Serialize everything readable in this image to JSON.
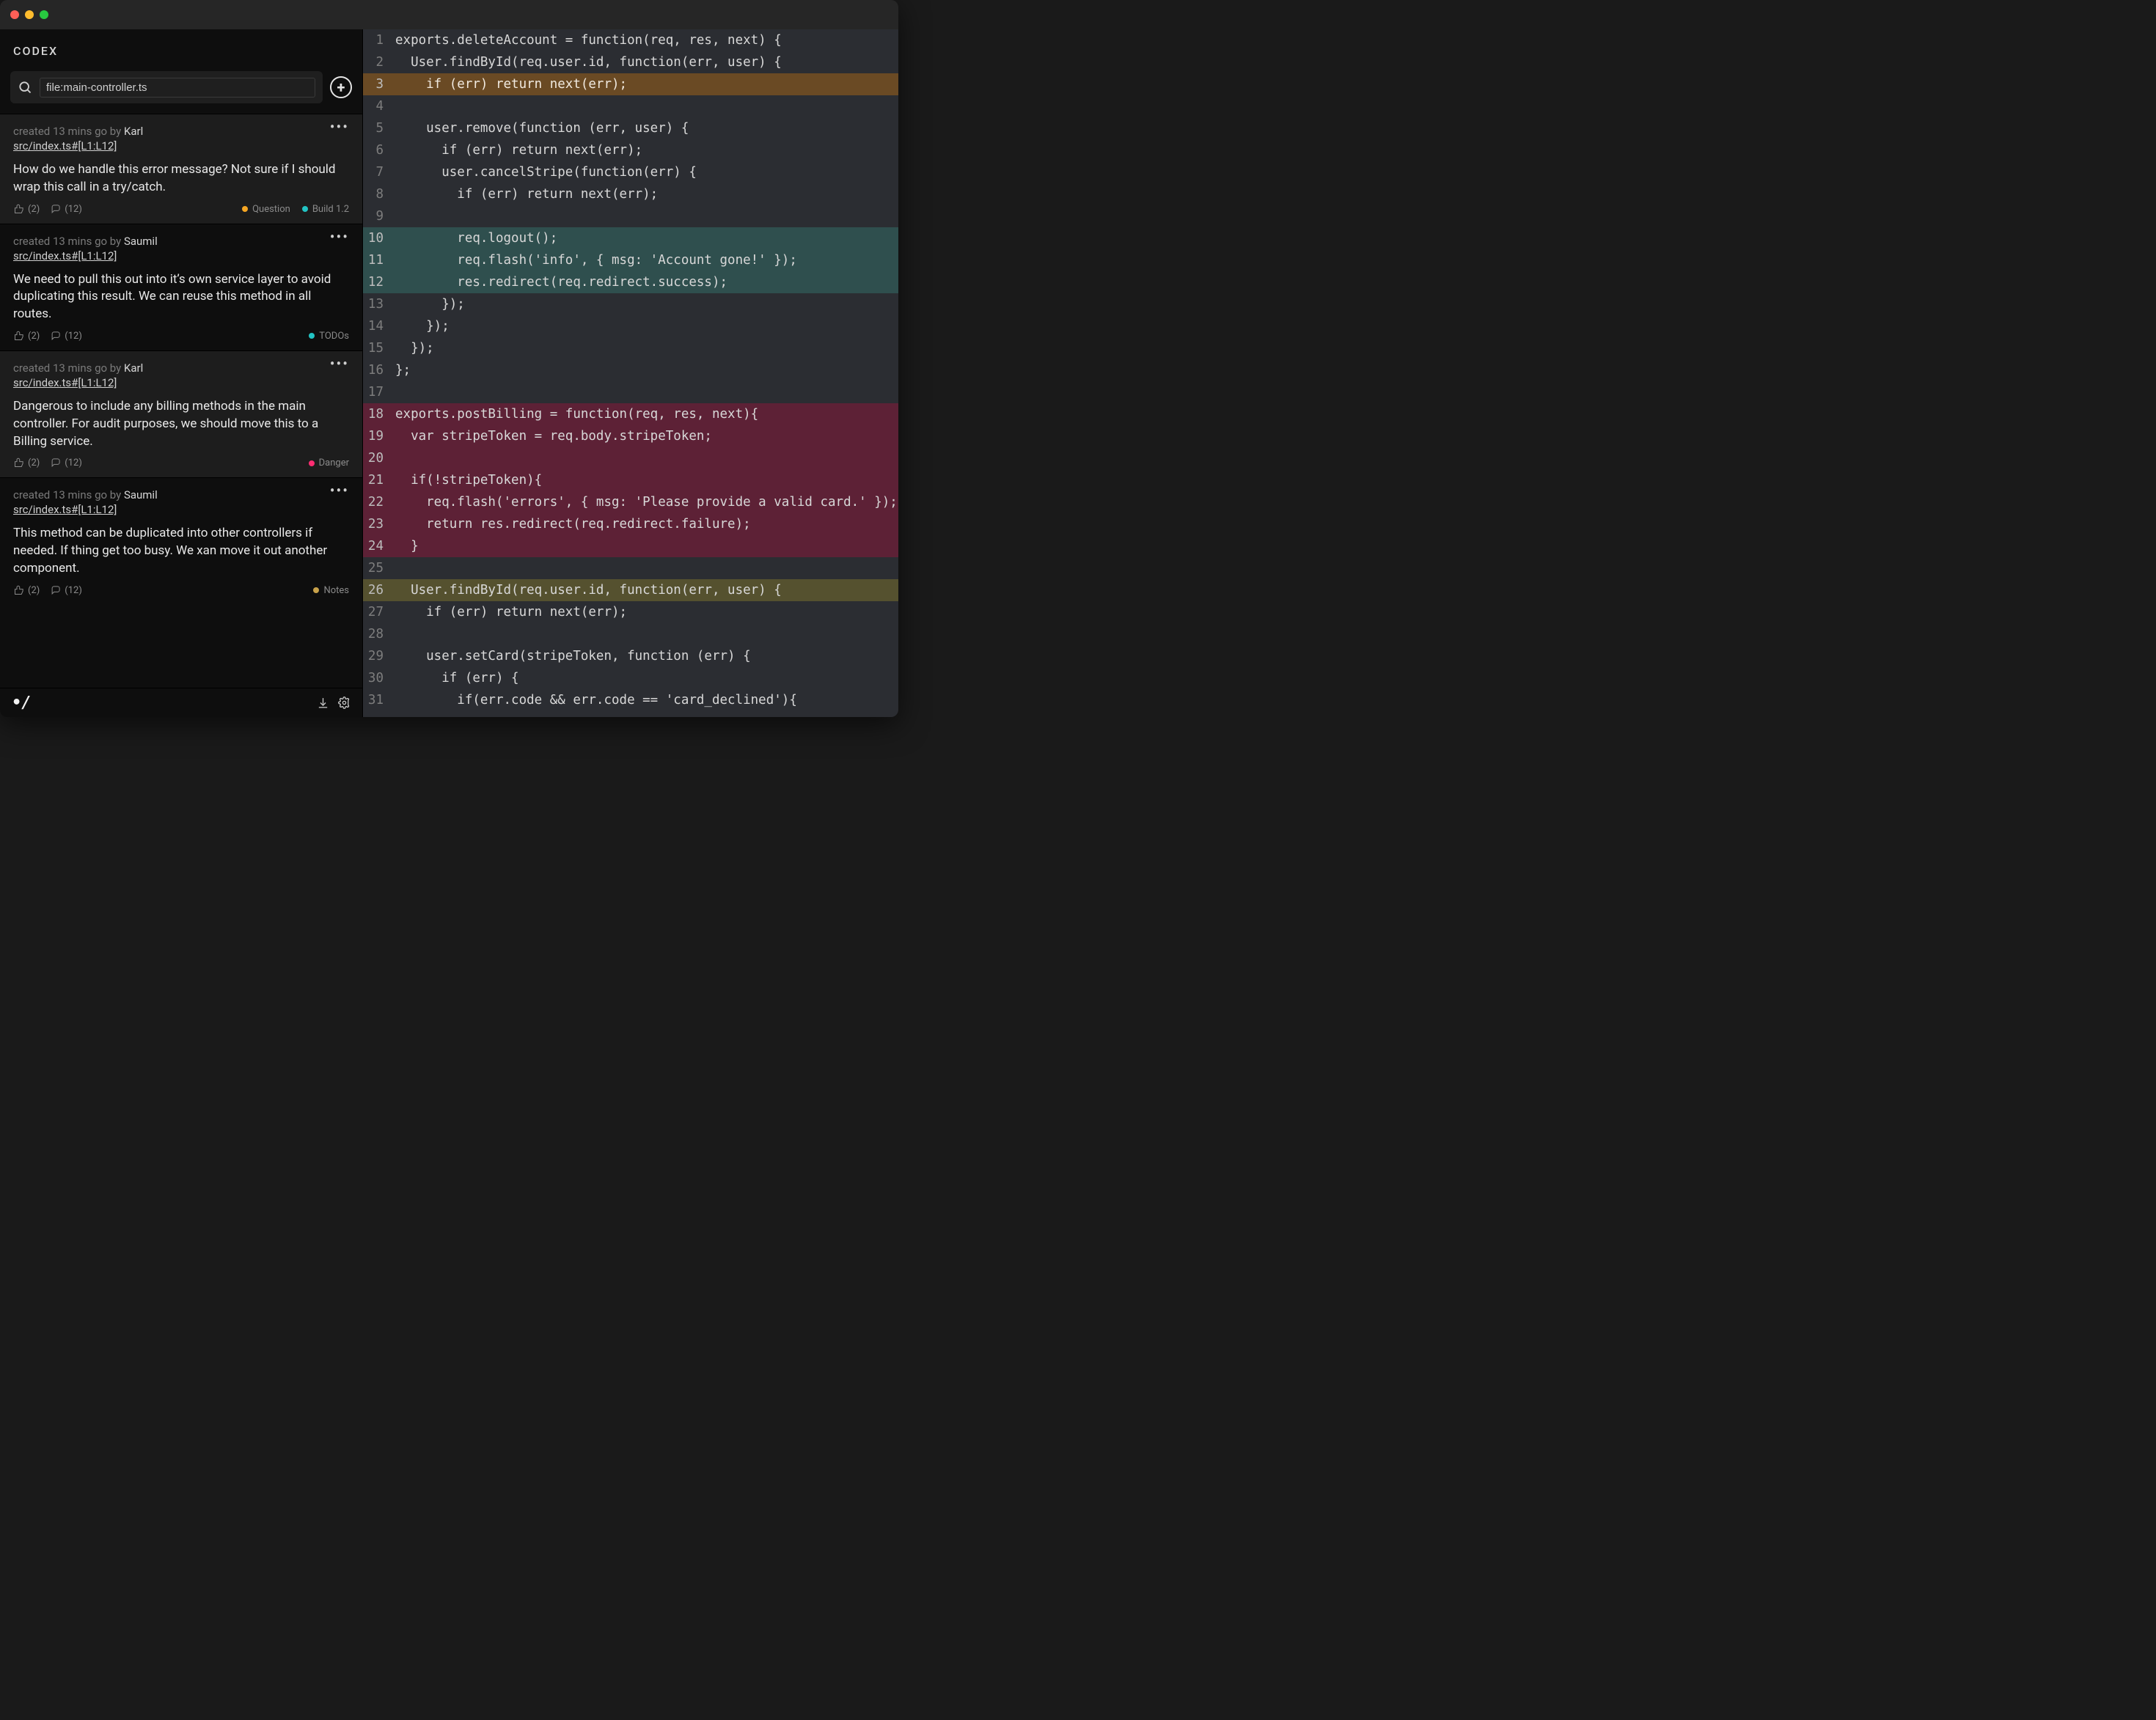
{
  "app": {
    "title": "CODEX"
  },
  "search": {
    "value": "file:main-controller.ts"
  },
  "colors": {
    "question": "#f5a623",
    "build": "#22c3c3",
    "todos": "#22c3c3",
    "danger": "#ff2d72",
    "notes": "#c9a24a"
  },
  "notes": [
    {
      "meta_prefix": "created 13 mins go by ",
      "author": "Karl",
      "file_ref": "src/index.ts#[L1:L12]",
      "text": "How do we handle this error message? Not sure if I should wrap this call in a try/catch.",
      "likes": "(2)",
      "comments": "(12)",
      "tags": [
        {
          "label": "Question",
          "color": "question"
        },
        {
          "label": "Build 1.2",
          "color": "build"
        }
      ],
      "alt": true
    },
    {
      "meta_prefix": "created 13 mins go by ",
      "author": "Saumil",
      "file_ref": "src/index.ts#[L1:L12]",
      "text": "We need to pull this out into it’s own service layer to avoid duplicating this result. We can reuse this method in all routes.",
      "likes": "(2)",
      "comments": "(12)",
      "tags": [
        {
          "label": "TODOs",
          "color": "todos"
        }
      ],
      "alt": false
    },
    {
      "meta_prefix": "created 13 mins go by ",
      "author": "Karl",
      "file_ref": "src/index.ts#[L1:L12]",
      "text": "Dangerous to include any billing methods in the main controller. For audit purposes, we should move this to a Billing service.",
      "likes": "(2)",
      "comments": "(12)",
      "tags": [
        {
          "label": "Danger",
          "color": "danger"
        }
      ],
      "alt": true
    },
    {
      "meta_prefix": "created 13 mins go by ",
      "author": "Saumil",
      "file_ref": "src/index.ts#[L1:L12]",
      "text": "This method can be duplicated into other controllers if needed. If thing get too busy. We xan move it out another component.",
      "likes": "(2)",
      "comments": "(12)",
      "tags": [
        {
          "label": "Notes",
          "color": "notes"
        }
      ],
      "alt": false
    }
  ],
  "code": {
    "lines": [
      {
        "n": 1,
        "t": "exports.deleteAccount = function(req, res, next) {",
        "hl": ""
      },
      {
        "n": 2,
        "t": "  User.findById(req.user.id, function(err, user) {",
        "hl": ""
      },
      {
        "n": 3,
        "t": "    if (err) return next(err);",
        "hl": "brown"
      },
      {
        "n": 4,
        "t": "",
        "hl": ""
      },
      {
        "n": 5,
        "t": "    user.remove(function (err, user) {",
        "hl": ""
      },
      {
        "n": 6,
        "t": "      if (err) return next(err);",
        "hl": ""
      },
      {
        "n": 7,
        "t": "      user.cancelStripe(function(err) {",
        "hl": ""
      },
      {
        "n": 8,
        "t": "        if (err) return next(err);",
        "hl": ""
      },
      {
        "n": 9,
        "t": "",
        "hl": ""
      },
      {
        "n": 10,
        "t": "        req.logout();",
        "hl": "teal"
      },
      {
        "n": 11,
        "t": "        req.flash('info', { msg: 'Account gone!' });",
        "hl": "teal"
      },
      {
        "n": 12,
        "t": "        res.redirect(req.redirect.success);",
        "hl": "teal"
      },
      {
        "n": 13,
        "t": "      });",
        "hl": ""
      },
      {
        "n": 14,
        "t": "    });",
        "hl": ""
      },
      {
        "n": 15,
        "t": "  });",
        "hl": ""
      },
      {
        "n": 16,
        "t": "};",
        "hl": ""
      },
      {
        "n": 17,
        "t": "",
        "hl": ""
      },
      {
        "n": 18,
        "t": "exports.postBilling = function(req, res, next){",
        "hl": "wine"
      },
      {
        "n": 19,
        "t": "  var stripeToken = req.body.stripeToken;",
        "hl": "wine"
      },
      {
        "n": 20,
        "t": "",
        "hl": "wine"
      },
      {
        "n": 21,
        "t": "  if(!stripeToken){",
        "hl": "wine"
      },
      {
        "n": 22,
        "t": "    req.flash('errors', { msg: 'Please provide a valid card.' });",
        "hl": "wine"
      },
      {
        "n": 23,
        "t": "    return res.redirect(req.redirect.failure);",
        "hl": "wine"
      },
      {
        "n": 24,
        "t": "  }",
        "hl": "wine"
      },
      {
        "n": 25,
        "t": "",
        "hl": ""
      },
      {
        "n": 26,
        "t": "  User.findById(req.user.id, function(err, user) {",
        "hl": "olive"
      },
      {
        "n": 27,
        "t": "    if (err) return next(err);",
        "hl": ""
      },
      {
        "n": 28,
        "t": "",
        "hl": ""
      },
      {
        "n": 29,
        "t": "    user.setCard(stripeToken, function (err) {",
        "hl": ""
      },
      {
        "n": 30,
        "t": "      if (err) {",
        "hl": ""
      },
      {
        "n": 31,
        "t": "        if(err.code && err.code == 'card_declined'){",
        "hl": ""
      }
    ]
  },
  "logo_text": "•/"
}
